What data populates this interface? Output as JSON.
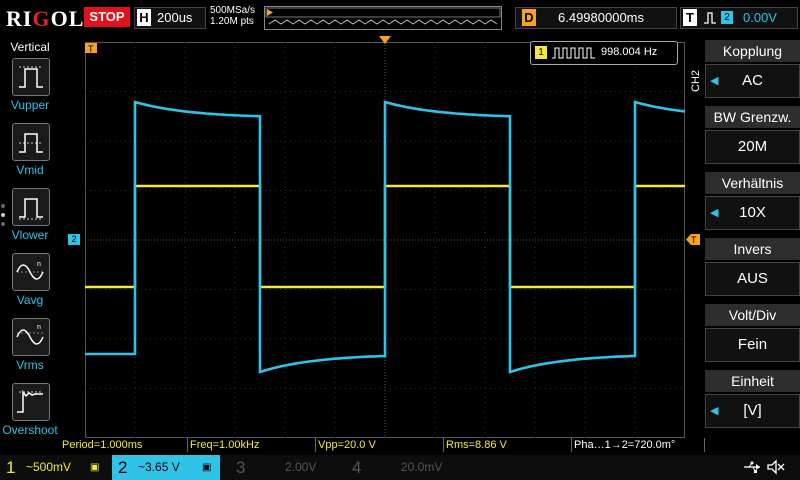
{
  "topbar": {
    "brand": "RIGOL",
    "run_state": "STOP",
    "timebase_letter": "H",
    "timebase": "200us",
    "sample_rate": "500MSa/s",
    "memory_depth": "1.20M pts",
    "delay_letter": "D",
    "delay": "6.49980000ms",
    "trigger_letter": "T",
    "trigger_source": "2",
    "trigger_level": "0.00V"
  },
  "left_menu": {
    "title": "Vertical",
    "items": [
      {
        "label": "Vupper",
        "icon": "vupper-icon"
      },
      {
        "label": "Vmid",
        "icon": "vmid-icon"
      },
      {
        "label": "Vlower",
        "icon": "vlower-icon"
      },
      {
        "label": "Vavg",
        "icon": "vavg-icon"
      },
      {
        "label": "Vrms",
        "icon": "vrms-icon"
      },
      {
        "label": "Overshoot",
        "icon": "overshoot-icon"
      }
    ]
  },
  "right_menu": {
    "channel_tag": "CH2",
    "items": [
      {
        "header": "Kopplung",
        "value": "AC",
        "has_arrow": true
      },
      {
        "header": "BW Grenzw.",
        "value": "20M",
        "has_arrow": false
      },
      {
        "header": "Verhältnis",
        "value": "10X",
        "has_arrow": true
      },
      {
        "header": "Invers",
        "value": "AUS",
        "has_arrow": false
      },
      {
        "header": "Volt/Div",
        "value": "Fein",
        "has_arrow": false
      },
      {
        "header": "Einheit",
        "value": "[V]",
        "has_arrow": true
      }
    ]
  },
  "frequency_counter": {
    "channel": "1",
    "value": "998.004 Hz"
  },
  "markers": {
    "ch2_offset_label": "2",
    "trigger_level_marker": "T"
  },
  "measurements": [
    {
      "text": "Period=1.000ms"
    },
    {
      "text": "Freq=1.00kHz"
    },
    {
      "text": "Vpp=20.0 V"
    },
    {
      "text": "Rms=8.86 V"
    },
    {
      "text": "Pha…1→2=720.0m°"
    }
  ],
  "channels": [
    {
      "number": "1",
      "value": "~500mV",
      "color": "#f3ea3a",
      "active": true
    },
    {
      "number": "2",
      "value": "~3.65 V",
      "color": "#2fc3e8",
      "active": true
    },
    {
      "number": "3",
      "value": "2.00V",
      "color": "#555555",
      "active": false
    },
    {
      "number": "4",
      "value": "20.0mV",
      "color": "#555555",
      "active": false
    }
  ],
  "colors": {
    "ch1": "#f3ea3a",
    "ch2": "#2fc3e8",
    "grid": "#3a3a3a",
    "trigger": "#f7a31c",
    "stop": "#e0131c"
  }
}
